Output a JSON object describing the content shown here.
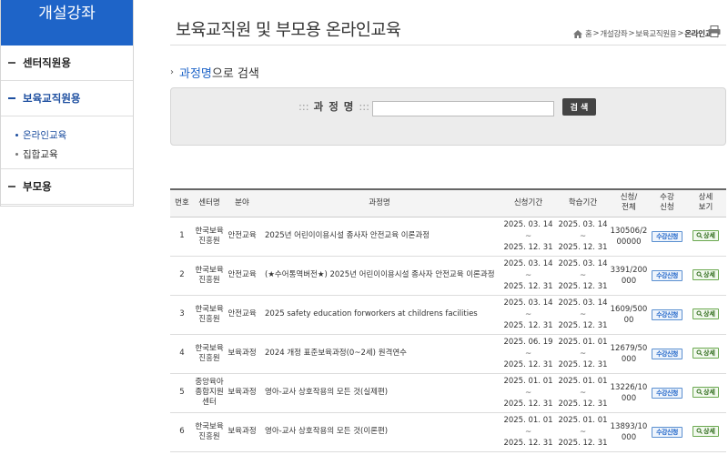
{
  "sidebar": {
    "title": "개설강좌",
    "menu": [
      {
        "label": "센터직원용"
      },
      {
        "label": "보육교직원용"
      }
    ],
    "submenu": [
      {
        "label": "온라인교육"
      },
      {
        "label": "집합교육"
      }
    ],
    "last_menu": {
      "label": "부모용"
    }
  },
  "header": {
    "title": "보육교직원 및 부모용 온라인교육",
    "breadcrumb": {
      "home": "홈",
      "sep": ">",
      "level1": "개설강좌",
      "level2": "보육교직원용",
      "current": "온라인교육"
    }
  },
  "search": {
    "heading_highlight": "과정명",
    "heading_rest": "으로 검색",
    "deco_left": ":::",
    "label": "과 정 명",
    "deco_right": ":::",
    "input_value": "",
    "button_label": "검 색"
  },
  "table": {
    "headers": {
      "no": "번호",
      "center": "센터명",
      "field": "분야",
      "title": "과정명",
      "apply_period": "신청기간",
      "study_period": "학습기간",
      "count": "신청/\n전체",
      "enroll": "수강\n신청",
      "detail": "상세\n보기"
    },
    "tilde": "~",
    "apply_label": "수강신청",
    "detail_label": "상세",
    "rows": [
      {
        "no": "1",
        "center": "한국보육진흥원",
        "field": "안전교육",
        "title": "2025년 어린이이용시설 종사자 안전교육 이론과정",
        "apply_start": "2025. 03. 14",
        "apply_end": "2025. 12. 31",
        "study_start": "2025. 03. 14",
        "study_end": "2025. 12. 31",
        "count": "130506/200000"
      },
      {
        "no": "2",
        "center": "한국보육진흥원",
        "field": "안전교육",
        "title": "(★수어통역버전★) 2025년 어린이이용시설 종사자 안전교육 이론과정",
        "apply_start": "2025. 03. 14",
        "apply_end": "2025. 12. 31",
        "study_start": "2025. 03. 14",
        "study_end": "2025. 12. 31",
        "count": "3391/200000"
      },
      {
        "no": "3",
        "center": "한국보육진흥원",
        "field": "안전교육",
        "title": "2025 safety education forworkers at childrens facilities",
        "apply_start": "2025. 03. 14",
        "apply_end": "2025. 12. 31",
        "study_start": "2025. 03. 14",
        "study_end": "2025. 12. 31",
        "count": "1609/50000"
      },
      {
        "no": "4",
        "center": "한국보육진흥원",
        "field": "보육과정",
        "title": "2024 개정 표준보육과정(0~2세) 원격연수",
        "apply_start": "2025. 06. 19",
        "apply_end": "2025. 12. 31",
        "study_start": "2025. 01. 01",
        "study_end": "2025. 12. 31",
        "count": "12679/50000"
      },
      {
        "no": "5",
        "center": "중앙육아종합지원센터",
        "field": "보육과정",
        "title": "영아-교사 상호작용의 모든 것(실제편)",
        "apply_start": "2025. 01. 01",
        "apply_end": "2025. 12. 31",
        "study_start": "2025. 01. 01",
        "study_end": "2025. 12. 31",
        "count": "13226/10000"
      },
      {
        "no": "6",
        "center": "한국보육진흥원",
        "field": "보육과정",
        "title": "영아-교사 상호작용의 모든 것(이론편)",
        "apply_start": "2025. 01. 01",
        "apply_end": "2025. 12. 31",
        "study_start": "2025. 01. 01",
        "study_end": "2025. 12. 31",
        "count": "13893/10000"
      }
    ]
  },
  "colors": {
    "brand": "#1e64c8",
    "apply_btn": "#1e64c8",
    "detail_btn": "#6aa84f"
  }
}
